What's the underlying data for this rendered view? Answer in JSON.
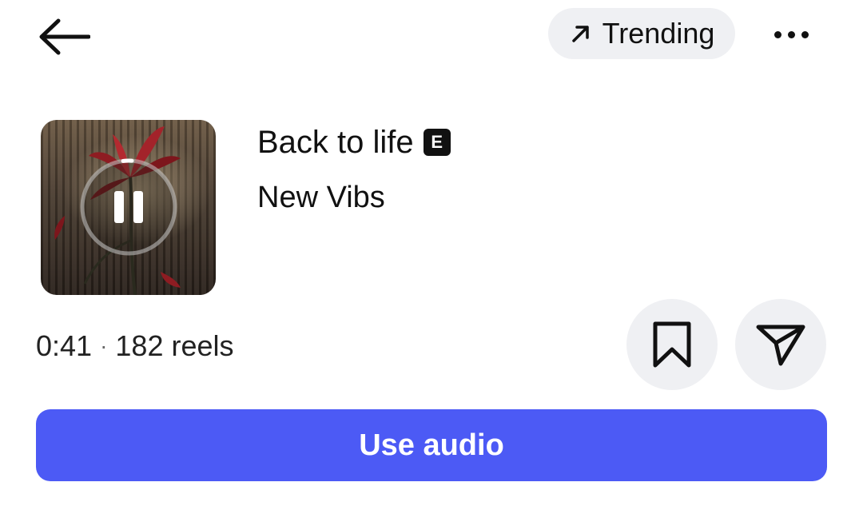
{
  "header": {
    "back_icon": "arrow-left-icon",
    "trending_label": "Trending",
    "trending_icon": "arrow-up-right-icon",
    "more_icon": "more-horizontal-icon"
  },
  "track": {
    "title": "Back to life",
    "explicit_badge": "E",
    "artist": "New Vibs",
    "cover_icon": "pause-icon",
    "playback_progress": 0.03
  },
  "meta": {
    "duration": "0:41",
    "separator": "·",
    "reels_count": "182 reels"
  },
  "actions": {
    "save_icon": "bookmark-icon",
    "share_icon": "send-icon",
    "use_audio_label": "Use audio"
  },
  "colors": {
    "accent": "#4c5af5",
    "pill_bg": "#eff0f3",
    "text": "#111111"
  }
}
